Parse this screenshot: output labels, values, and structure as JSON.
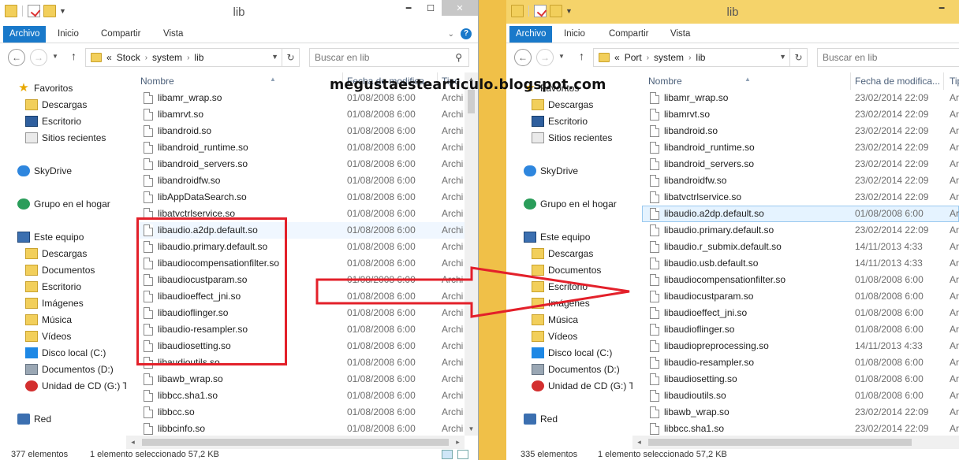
{
  "watermark": "megustaestearticulo.blogspot.com",
  "colors": {
    "red_annotation": "#e3202a",
    "ribbon_file": "#1979ca",
    "right_title_bar": "#f5d36a"
  },
  "left": {
    "title": "lib",
    "ribbon": {
      "file": "Archivo",
      "home": "Inicio",
      "share": "Compartir",
      "view": "Vista"
    },
    "address": {
      "chevrons": "«",
      "crumbs": [
        "Stock",
        "system",
        "lib"
      ]
    },
    "search_placeholder": "Buscar en lib",
    "columns": {
      "name": "Nombre",
      "date": "Fecha de modifica...",
      "type": "Tipo"
    },
    "nav": [
      {
        "label": "Favoritos",
        "icon": "star-icon"
      },
      {
        "label": "Descargas",
        "icon": "folder-icon"
      },
      {
        "label": "Escritorio",
        "icon": "desktop-icon"
      },
      {
        "label": "Sitios recientes",
        "icon": "recent-icon"
      },
      {
        "label": "SkyDrive",
        "icon": "cloud-icon"
      },
      {
        "label": "Grupo en el hogar",
        "icon": "homegroup-icon"
      },
      {
        "label": "Este equipo",
        "icon": "computer-icon"
      },
      {
        "label": "Descargas",
        "icon": "folder-icon"
      },
      {
        "label": "Documentos",
        "icon": "folder-icon"
      },
      {
        "label": "Escritorio",
        "icon": "folder-icon"
      },
      {
        "label": "Imágenes",
        "icon": "folder-icon"
      },
      {
        "label": "Música",
        "icon": "music-icon"
      },
      {
        "label": "Vídeos",
        "icon": "folder-icon"
      },
      {
        "label": "Disco local (C:)",
        "icon": "windows-drive-icon"
      },
      {
        "label": "Documentos (D:)",
        "icon": "drive-icon"
      },
      {
        "label": "Unidad de CD (G:) T",
        "icon": "cd-icon"
      },
      {
        "label": "Red",
        "icon": "network-icon"
      }
    ],
    "files": [
      {
        "name": "libamr_wrap.so",
        "date": "01/08/2008 6:00",
        "type": "Archi"
      },
      {
        "name": "libamrvt.so",
        "date": "01/08/2008 6:00",
        "type": "Archi"
      },
      {
        "name": "libandroid.so",
        "date": "01/08/2008 6:00",
        "type": "Archi"
      },
      {
        "name": "libandroid_runtime.so",
        "date": "01/08/2008 6:00",
        "type": "Archi"
      },
      {
        "name": "libandroid_servers.so",
        "date": "01/08/2008 6:00",
        "type": "Archi"
      },
      {
        "name": "libandroidfw.so",
        "date": "01/08/2008 6:00",
        "type": "Archi"
      },
      {
        "name": "libAppDataSearch.so",
        "date": "01/08/2008 6:00",
        "type": "Archi"
      },
      {
        "name": "libatvctrlservice.so",
        "date": "01/08/2008 6:00",
        "type": "Archi"
      },
      {
        "name": "libaudio.a2dp.default.so",
        "date": "01/08/2008 6:00",
        "type": "Archi"
      },
      {
        "name": "libaudio.primary.default.so",
        "date": "01/08/2008 6:00",
        "type": "Archi"
      },
      {
        "name": "libaudiocompensationfilter.so",
        "date": "01/08/2008 6:00",
        "type": "Archi"
      },
      {
        "name": "libaudiocustparam.so",
        "date": "01/08/2008 6:00",
        "type": "Archi"
      },
      {
        "name": "libaudioeffect_jni.so",
        "date": "01/08/2008 6:00",
        "type": "Archi"
      },
      {
        "name": "libaudioflinger.so",
        "date": "01/08/2008 6:00",
        "type": "Archi"
      },
      {
        "name": "libaudio-resampler.so",
        "date": "01/08/2008 6:00",
        "type": "Archi"
      },
      {
        "name": "libaudiosetting.so",
        "date": "01/08/2008 6:00",
        "type": "Archi"
      },
      {
        "name": "libaudioutils.so",
        "date": "01/08/2008 6:00",
        "type": "Archi"
      },
      {
        "name": "libawb_wrap.so",
        "date": "01/08/2008 6:00",
        "type": "Archi"
      },
      {
        "name": "libbcc.sha1.so",
        "date": "01/08/2008 6:00",
        "type": "Archi"
      },
      {
        "name": "libbcc.so",
        "date": "01/08/2008 6:00",
        "type": "Archi"
      },
      {
        "name": "libbcinfo.so",
        "date": "01/08/2008 6:00",
        "type": "Archi"
      }
    ],
    "status": {
      "count": "377 elementos",
      "selection": "1 elemento seleccionado  57,2 KB"
    }
  },
  "right": {
    "title": "lib",
    "ribbon": {
      "file": "Archivo",
      "home": "Inicio",
      "share": "Compartir",
      "view": "Vista"
    },
    "address": {
      "chevrons": "«",
      "crumbs": [
        "Port",
        "system",
        "lib"
      ]
    },
    "search_placeholder": "Buscar en lib",
    "columns": {
      "name": "Nombre",
      "date": "Fecha de modifica...",
      "type": "Tip"
    },
    "nav": [
      {
        "label": "Favoritos",
        "icon": "star-icon"
      },
      {
        "label": "Descargas",
        "icon": "folder-icon"
      },
      {
        "label": "Escritorio",
        "icon": "desktop-icon"
      },
      {
        "label": "Sitios recientes",
        "icon": "recent-icon"
      },
      {
        "label": "SkyDrive",
        "icon": "cloud-icon"
      },
      {
        "label": "Grupo en el hogar",
        "icon": "homegroup-icon"
      },
      {
        "label": "Este equipo",
        "icon": "computer-icon"
      },
      {
        "label": "Descargas",
        "icon": "folder-icon"
      },
      {
        "label": "Documentos",
        "icon": "folder-icon"
      },
      {
        "label": "Escritorio",
        "icon": "folder-icon"
      },
      {
        "label": "Imágenes",
        "icon": "folder-icon"
      },
      {
        "label": "Música",
        "icon": "music-icon"
      },
      {
        "label": "Vídeos",
        "icon": "folder-icon"
      },
      {
        "label": "Disco local (C:)",
        "icon": "windows-drive-icon"
      },
      {
        "label": "Documentos (D:)",
        "icon": "drive-icon"
      },
      {
        "label": "Unidad de CD (G:) T",
        "icon": "cd-icon"
      },
      {
        "label": "Red",
        "icon": "network-icon"
      }
    ],
    "files": [
      {
        "name": "libamr_wrap.so",
        "date": "23/02/2014 22:09",
        "type": "Ar"
      },
      {
        "name": "libamrvt.so",
        "date": "23/02/2014 22:09",
        "type": "Ar"
      },
      {
        "name": "libandroid.so",
        "date": "23/02/2014 22:09",
        "type": "Ar"
      },
      {
        "name": "libandroid_runtime.so",
        "date": "23/02/2014 22:09",
        "type": "Ar"
      },
      {
        "name": "libandroid_servers.so",
        "date": "23/02/2014 22:09",
        "type": "Ar"
      },
      {
        "name": "libandroidfw.so",
        "date": "23/02/2014 22:09",
        "type": "Ar"
      },
      {
        "name": "libatvctrlservice.so",
        "date": "23/02/2014 22:09",
        "type": "Ar"
      },
      {
        "name": "libaudio.a2dp.default.so",
        "date": "01/08/2008 6:00",
        "type": "Ar"
      },
      {
        "name": "libaudio.primary.default.so",
        "date": "23/02/2014 22:09",
        "type": "Ar"
      },
      {
        "name": "libaudio.r_submix.default.so",
        "date": "14/11/2013 4:33",
        "type": "Ar"
      },
      {
        "name": "libaudio.usb.default.so",
        "date": "14/11/2013 4:33",
        "type": "Ar"
      },
      {
        "name": "libaudiocompensationfilter.so",
        "date": "01/08/2008 6:00",
        "type": "Ar"
      },
      {
        "name": "libaudiocustparam.so",
        "date": "01/08/2008 6:00",
        "type": "Ar"
      },
      {
        "name": "libaudioeffect_jni.so",
        "date": "01/08/2008 6:00",
        "type": "Ar"
      },
      {
        "name": "libaudioflinger.so",
        "date": "01/08/2008 6:00",
        "type": "Ar"
      },
      {
        "name": "libaudiopreprocessing.so",
        "date": "14/11/2013 4:33",
        "type": "Ar"
      },
      {
        "name": "libaudio-resampler.so",
        "date": "01/08/2008 6:00",
        "type": "Ar"
      },
      {
        "name": "libaudiosetting.so",
        "date": "01/08/2008 6:00",
        "type": "Ar"
      },
      {
        "name": "libaudioutils.so",
        "date": "01/08/2008 6:00",
        "type": "Ar"
      },
      {
        "name": "libawb_wrap.so",
        "date": "23/02/2014 22:09",
        "type": "Ar"
      },
      {
        "name": "libbcc.sha1.so",
        "date": "23/02/2014 22:09",
        "type": "Ar"
      }
    ],
    "status": {
      "count": "335 elementos",
      "selection": "1 elemento seleccionado  57,2 KB"
    }
  }
}
